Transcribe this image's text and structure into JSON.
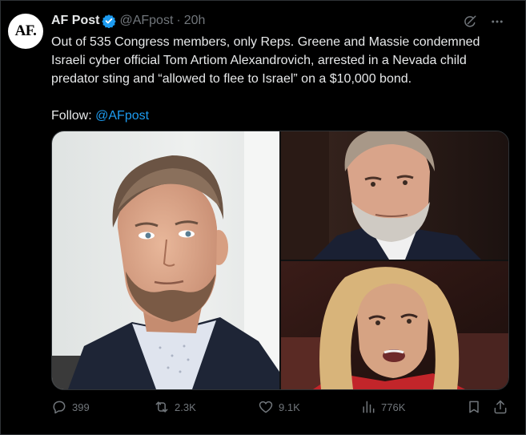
{
  "author": {
    "avatar_text": "AF.",
    "name": "AF Post",
    "handle": "@AFpost",
    "separator": "·",
    "time": "20h"
  },
  "tweet": {
    "text": "Out of 535 Congress members, only Reps. Greene and Massie condemned Israeli cyber official Tom Artiom Alexandrovich, arrested in a Nevada child predator sting and “allowed to flee to Israel” on a $10,000 bond.",
    "follow_prefix": "Follow: ",
    "follow_link": "@AFpost"
  },
  "metrics": {
    "replies": "399",
    "reposts": "2.3K",
    "likes": "9.1K",
    "views": "776K"
  },
  "colors": {
    "background": "#000000",
    "text": "#e7e9ea",
    "muted": "#71767b",
    "link": "#1d9bf0",
    "verified": "#1d9bf0",
    "border": "#2f3336"
  },
  "icons": {
    "verified": "verified-badge-icon",
    "grok": "grok-icon",
    "more": "more-icon",
    "reply": "reply-icon",
    "repost": "repost-icon",
    "like": "like-icon",
    "views": "views-icon",
    "bookmark": "bookmark-icon",
    "share": "share-icon"
  }
}
